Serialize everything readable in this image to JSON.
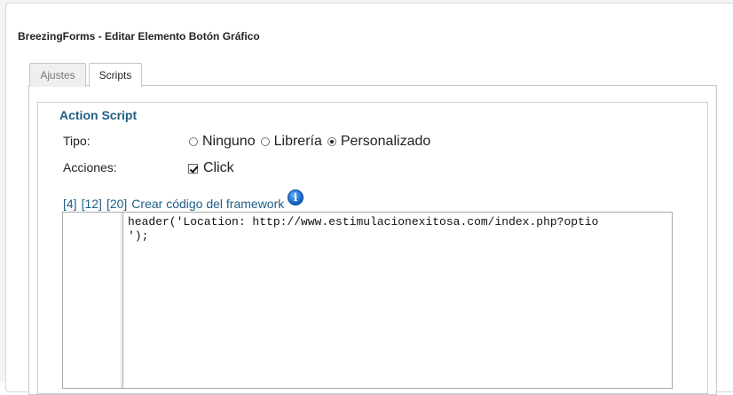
{
  "window": {
    "title": "BreezingForms - Editar Elemento Botón Gráfico"
  },
  "tabs": [
    {
      "label": "Ajustes",
      "active": false
    },
    {
      "label": "Scripts",
      "active": true
    }
  ],
  "action_script": {
    "legend": "Action Script",
    "tipo": {
      "label": "Tipo:",
      "options": [
        {
          "label": "Ninguno",
          "checked": false
        },
        {
          "label": "Librería",
          "checked": false
        },
        {
          "label": "Personalizado",
          "checked": true
        }
      ]
    },
    "acciones": {
      "label": "Acciones:",
      "checkbox_label": "Click",
      "checked": true
    },
    "links": {
      "l4": "[4]",
      "l12": "[12]",
      "l20": "[20]",
      "framework": "Crear código del framework"
    },
    "info_icon": "info-icon",
    "code": {
      "line1": "header('Location: http://www.estimulacionexitosa.com/index.php?optio",
      "line2": "');"
    }
  },
  "colors": {
    "accent": "#1f5f86",
    "border": "#c7c7c7"
  }
}
